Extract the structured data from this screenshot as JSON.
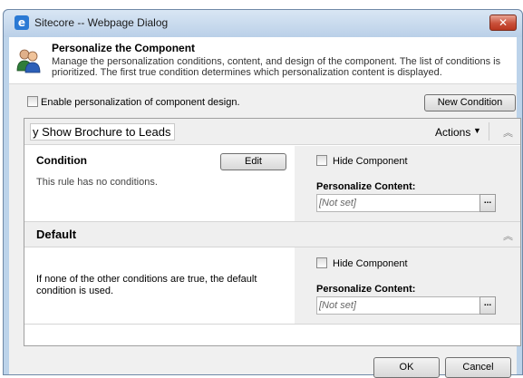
{
  "window": {
    "title": "Sitecore -- Webpage Dialog",
    "close_symbol": "✕"
  },
  "header": {
    "title": "Personalize the Component",
    "description": "Manage the personalization conditions, content, and design of the component. The list of conditions is prioritized. The first true condition determines which personalization content is displayed.",
    "icon": "users-icon"
  },
  "toolbar": {
    "enable_label": "Enable personalization of component design.",
    "enable_checked": false,
    "new_condition_label": "New Condition"
  },
  "rules": [
    {
      "name": "y Show Brochure to Leads",
      "actions_label": "Actions",
      "condition_label": "Condition",
      "condition_text": "This rule has no conditions.",
      "edit_label": "Edit",
      "hide_component_label": "Hide Component",
      "hide_component_checked": false,
      "personalize_content_label": "Personalize Content:",
      "content_value": "[Not set]",
      "browse_label": "..."
    }
  ],
  "default_rule": {
    "title": "Default",
    "description": "If none of the other conditions are true, the default condition is used.",
    "hide_component_label": "Hide Component",
    "hide_component_checked": false,
    "personalize_content_label": "Personalize Content:",
    "content_value": "[Not set]",
    "browse_label": "..."
  },
  "footer": {
    "ok_label": "OK",
    "cancel_label": "Cancel"
  },
  "colors": {
    "title_bar": "#bad0e8",
    "close_button": "#c9503a",
    "panel_header": "#efefef"
  }
}
